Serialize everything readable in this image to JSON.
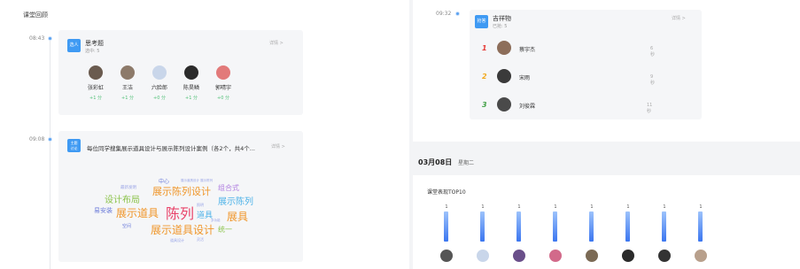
{
  "section_title": "课堂回顾",
  "timeline": [
    {
      "time": "08:43",
      "tag": "选人",
      "title": "思考题",
      "subtitle": "选中: 5",
      "detail": "详情 >",
      "students": [
        {
          "name": "张彩虹",
          "score": "+1 分",
          "color": "#6a5b4f"
        },
        {
          "name": "王洁",
          "score": "+1 分",
          "color": "#8d7a6a"
        },
        {
          "name": "六脸郎",
          "score": "+0 分",
          "color": "#c9d6ea"
        },
        {
          "name": "陈昊鳞",
          "score": "+1 分",
          "color": "#2b2b2b"
        },
        {
          "name": "郭晴宇",
          "score": "+0 分",
          "color": "#e27a7a"
        }
      ]
    },
    {
      "time": "09:08",
      "tag_line1": "主题",
      "tag_line2": "讨论",
      "title": "每位同学搜集展示道具设计与展示陈列设计案例（各2个，共4个...",
      "detail": "详情 >",
      "word_cloud": [
        {
          "text": "中心",
          "color": "#6b7bd9"
        },
        {
          "text": "展示道具设计 展示陈列",
          "color": "#9aa5e6"
        },
        {
          "text": "展示陈列设计",
          "color": "#f0962a"
        },
        {
          "text": "组合式",
          "color": "#b07ee0"
        },
        {
          "text": "最新发明",
          "color": "#9aa5e6"
        },
        {
          "text": "设计布局",
          "color": "#8bc34a"
        },
        {
          "text": "展示陈列",
          "color": "#4fb3e8"
        },
        {
          "text": "照明",
          "color": "#9aa5e6"
        },
        {
          "text": "易安装",
          "color": "#6b7bd9"
        },
        {
          "text": "展示道具",
          "color": "#f0962a"
        },
        {
          "text": "陈列",
          "color": "#e9456b"
        },
        {
          "text": "道具",
          "color": "#4fb3e8"
        },
        {
          "text": "展具",
          "color": "#f0962a"
        },
        {
          "text": "多功能",
          "color": "#9aa5e6"
        },
        {
          "text": "空间",
          "color": "#6b7bd9"
        },
        {
          "text": "展示道具设计",
          "color": "#f0962a"
        },
        {
          "text": "统一",
          "color": "#8bc34a"
        },
        {
          "text": "道具设计",
          "color": "#9aa5e6"
        },
        {
          "text": "灵活",
          "color": "#9aa5e6"
        }
      ]
    }
  ],
  "right_card": {
    "time": "09:32",
    "tag": "抢答",
    "title": "吉祥物",
    "subtitle": "已抢: 5",
    "detail": "详情 >",
    "ranks": [
      {
        "rank": "1",
        "name": "蔡宇杰",
        "time": "6 秒",
        "color": "#e53935",
        "avatar": "#8d6e5a"
      },
      {
        "rank": "2",
        "name": "宋雨",
        "time": "9 秒",
        "color": "#f2a91e",
        "avatar": "#3a3a3a"
      },
      {
        "rank": "3",
        "name": "刘俊霖",
        "time": "11 秒",
        "color": "#43a047",
        "avatar": "#4a4a4a"
      }
    ]
  },
  "date": {
    "main": "03月08日",
    "weekday": "星期二"
  },
  "performance": {
    "title": "课堂表现TOP10",
    "bars": [
      {
        "value": "1",
        "avatar": "#555"
      },
      {
        "value": "1",
        "avatar": "#c9d6ea"
      },
      {
        "value": "1",
        "avatar": "#6a4f8a"
      },
      {
        "value": "1",
        "avatar": "#d26a8a"
      },
      {
        "value": "1",
        "avatar": "#7b6a55"
      },
      {
        "value": "1",
        "avatar": "#2b2b2b"
      },
      {
        "value": "1",
        "avatar": "#333"
      },
      {
        "value": "1",
        "avatar": "#b8a08c"
      }
    ]
  }
}
